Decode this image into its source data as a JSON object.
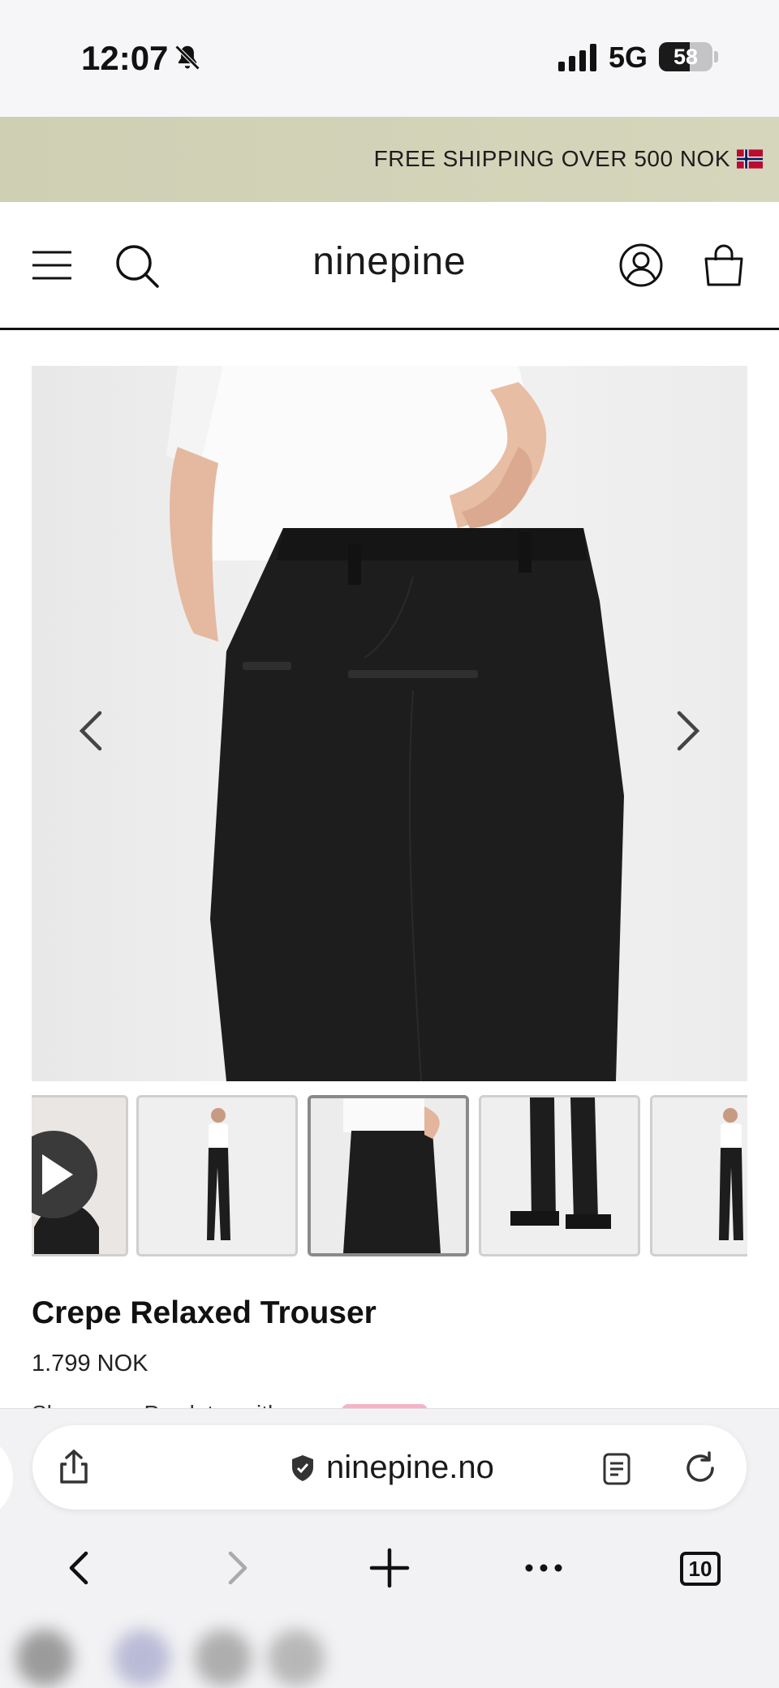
{
  "status_bar": {
    "time": "12:07",
    "network": "5G",
    "battery": "58",
    "battery_level": 0.58
  },
  "promo": {
    "text": "FREE SHIPPING OVER 500 NOK",
    "flag": "norway-flag"
  },
  "header": {
    "logo": "ninepine",
    "menu_icon": "hamburger-menu-icon",
    "search_icon": "search-icon",
    "account_icon": "account-icon",
    "cart_icon": "shopping-bag-icon"
  },
  "product": {
    "title": "Crepe Relaxed Trouser",
    "price": "1.799 NOK",
    "payment_text": "Shop now. Pay later with",
    "payment_badge": "Klarna",
    "thumbnail_count": 5,
    "active_thumbnail": 3
  },
  "browser": {
    "url": "ninepine.no",
    "tab_count": "10"
  }
}
